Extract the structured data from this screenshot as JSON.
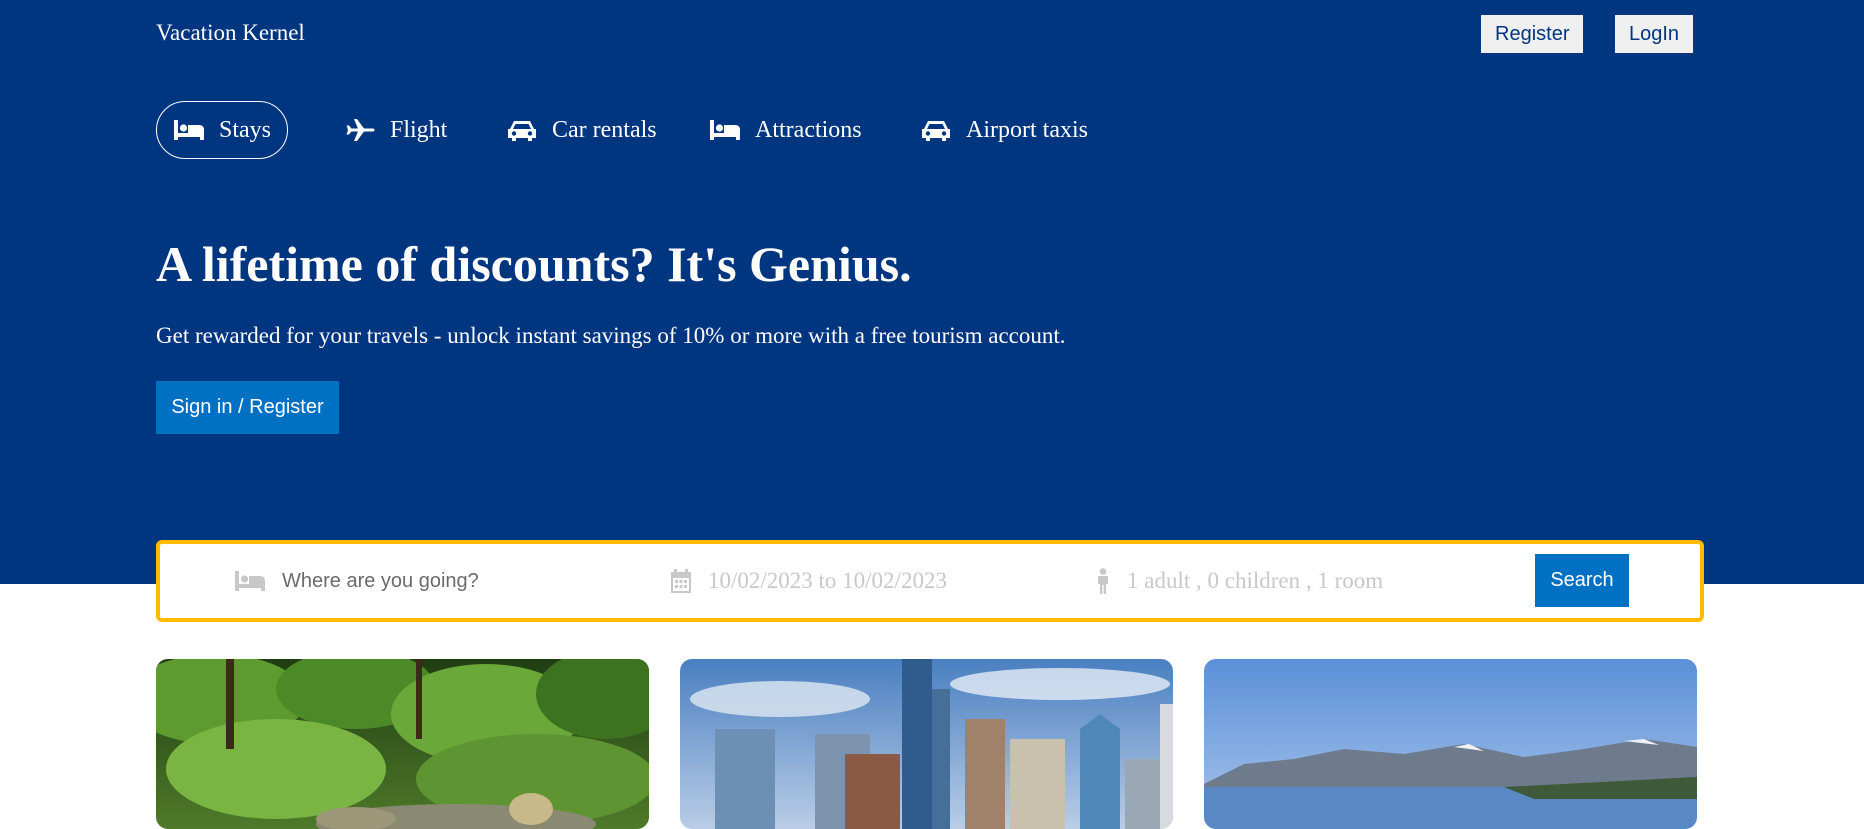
{
  "header": {
    "brand": "Vacation Kernel",
    "register_label": "Register",
    "login_label": "LogIn"
  },
  "nav": {
    "items": [
      {
        "label": "Stays",
        "icon": "bed-icon",
        "active": true
      },
      {
        "label": "Flight",
        "icon": "plane-icon",
        "active": false
      },
      {
        "label": "Car rentals",
        "icon": "car-icon",
        "active": false
      },
      {
        "label": "Attractions",
        "icon": "bed-icon",
        "active": false
      },
      {
        "label": "Airport taxis",
        "icon": "car-icon",
        "active": false
      }
    ]
  },
  "hero": {
    "headline": "A lifetime of discounts? It's Genius.",
    "subtext": "Get rewarded for your travels - unlock instant savings of 10% or more with a free tourism account.",
    "cta_label": "Sign in / Register"
  },
  "search": {
    "destination_placeholder": "Where are you going?",
    "destination_value": "",
    "dates": "10/02/2023 to 10/02/2023",
    "guests": "1 adult , 0 children , 1 room",
    "button_label": "Search"
  },
  "cards": [
    {
      "image": "forest-stream-photo"
    },
    {
      "image": "city-skyline-photo"
    },
    {
      "image": "mountain-lake-photo"
    }
  ],
  "colors": {
    "hero_bg": "#003580",
    "accent_blue": "#0071c2",
    "search_border": "#febb02"
  }
}
